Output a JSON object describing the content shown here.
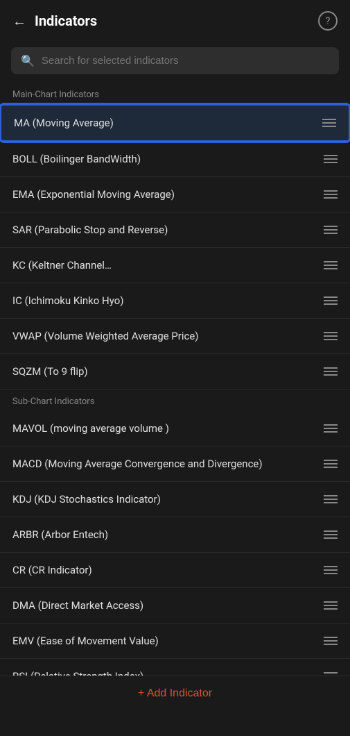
{
  "header": {
    "title": "Indicators",
    "back_label": "←",
    "help_label": "?"
  },
  "search": {
    "placeholder": "Search for selected indicators"
  },
  "sections": [
    {
      "label": "Main-Chart Indicators",
      "items": [
        {
          "id": "ma",
          "name": "MA (Moving Average)",
          "highlighted": true
        },
        {
          "id": "boll",
          "name": "BOLL (Boilinger BandWidth)",
          "highlighted": false
        },
        {
          "id": "ema",
          "name": "EMA (Exponential Moving Average)",
          "highlighted": false
        },
        {
          "id": "sar",
          "name": "SAR (Parabolic Stop and Reverse)",
          "highlighted": false
        },
        {
          "id": "kc",
          "name": "KC (Keltner Channel…",
          "highlighted": false
        },
        {
          "id": "ic",
          "name": "IC (Ichimoku Kinko Hyo)",
          "highlighted": false
        },
        {
          "id": "vwap",
          "name": "VWAP (Volume Weighted Average Price)",
          "highlighted": false
        },
        {
          "id": "sqzm",
          "name": "SQZM (To 9 flip)",
          "highlighted": false
        }
      ]
    },
    {
      "label": "Sub-Chart Indicators",
      "items": [
        {
          "id": "mavol",
          "name": "MAVOL (moving average volume )",
          "highlighted": false
        },
        {
          "id": "macd",
          "name": "MACD (Moving Average Convergence and Divergence)",
          "highlighted": false
        },
        {
          "id": "kdj",
          "name": "KDJ (KDJ Stochastics Indicator)",
          "highlighted": false
        },
        {
          "id": "arbr",
          "name": "ARBR (Arbor Entech)",
          "highlighted": false
        },
        {
          "id": "cr",
          "name": "CR (CR Indicator)",
          "highlighted": false
        },
        {
          "id": "dma",
          "name": "DMA (Direct Market Access)",
          "highlighted": false
        },
        {
          "id": "emv",
          "name": "EMV (Ease of Movement Value)",
          "highlighted": false
        },
        {
          "id": "rsi",
          "name": "RSI (Relative Strength Index)",
          "highlighted": false
        }
      ]
    }
  ],
  "add_indicator": {
    "label": "+ Add Indicator"
  }
}
